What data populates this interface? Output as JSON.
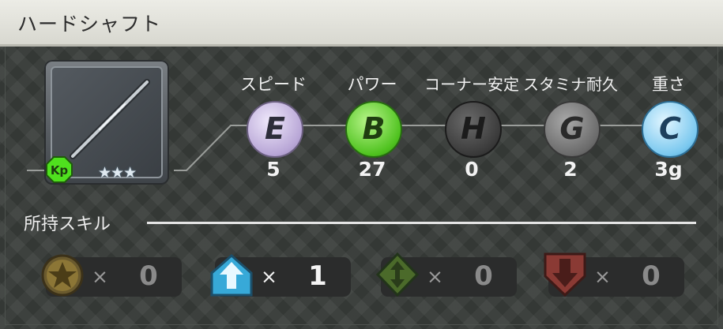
{
  "window": {
    "title": "ハードシャフト"
  },
  "item": {
    "stars": "★★★",
    "badge": "Kp",
    "icon": "shaft-icon"
  },
  "stats": [
    {
      "label": "スピード",
      "grade": "E",
      "value": "5",
      "color": "#cdbfe6"
    },
    {
      "label": "パワー",
      "grade": "B",
      "value": "27",
      "color": "#6fd23a"
    },
    {
      "label": "コーナー安定",
      "grade": "H",
      "value": "0",
      "color": "#4a4a4a"
    },
    {
      "label": "スタミナ耐久",
      "grade": "G",
      "value": "2",
      "color": "#6e6e6e"
    },
    {
      "label": "重さ",
      "grade": "C",
      "value": "3g",
      "color": "#8fd3f4"
    }
  ],
  "skills": {
    "title": "所持スキル",
    "items": [
      {
        "icon": "star-medal-icon",
        "mult": "×",
        "count": "0"
      },
      {
        "icon": "arrow-up-icon",
        "mult": "×",
        "count": "1"
      },
      {
        "icon": "arrow-updown-icon",
        "mult": "×",
        "count": "0"
      },
      {
        "icon": "arrow-down-icon",
        "mult": "×",
        "count": "0"
      }
    ]
  }
}
